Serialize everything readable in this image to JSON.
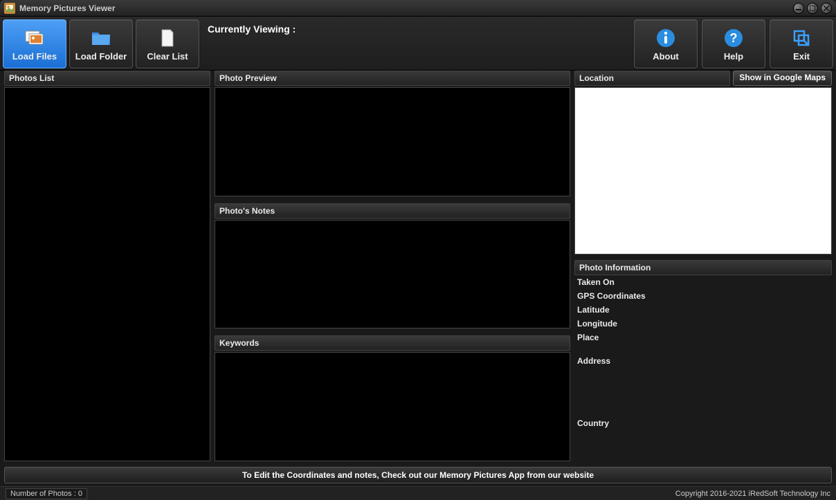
{
  "window": {
    "title": "Memory Pictures Viewer"
  },
  "toolbar": {
    "load_files": "Load Files",
    "load_folder": "Load Folder",
    "clear_list": "Clear List",
    "currently_viewing_label": "Currently Viewing :",
    "about": "About",
    "help": "Help",
    "exit": "Exit"
  },
  "panels": {
    "photos_list": "Photos List",
    "photo_preview": "Photo Preview",
    "photos_notes": "Photo's Notes",
    "keywords": "Keywords",
    "location": "Location",
    "show_in_maps": "Show in Google Maps",
    "photo_information": "Photo Information"
  },
  "info": {
    "taken_on": "Taken On",
    "gps_coordinates": "GPS Coordinates",
    "latitude": "Latitude",
    "longitude": "Longitude",
    "place": "Place",
    "address": "Address",
    "country": "Country"
  },
  "footer": {
    "message": "To Edit the Coordinates and notes, Check out our Memory Pictures App from our website"
  },
  "status": {
    "photo_count": "Number of Photos : 0",
    "copyright": "Copyright 2016-2021 iRedSoft Technology Inc"
  }
}
